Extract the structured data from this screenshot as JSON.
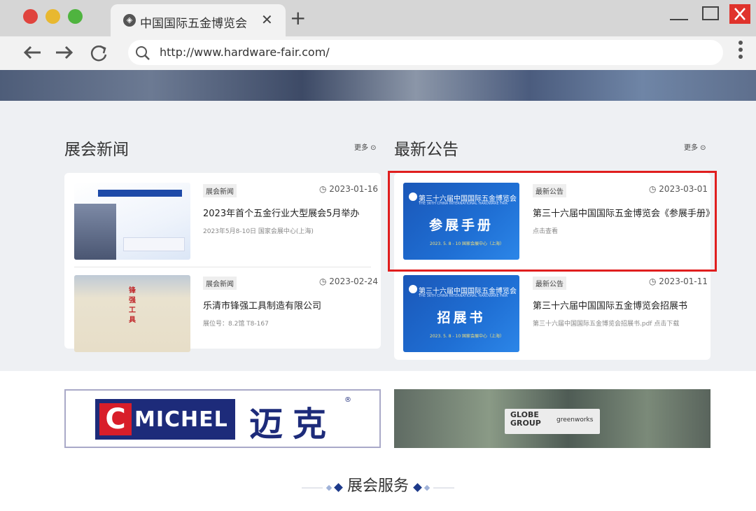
{
  "browser": {
    "tab_title": "中国国际五金博览会",
    "tab_close": "✕",
    "new_tab": "+",
    "url": "http://www.hardware-fair.com/"
  },
  "news": {
    "title": "展会新闻",
    "more": "更多 ⊙",
    "items": [
      {
        "tag": "展会新闻",
        "date": "2023-01-16",
        "title": "2023年首个五金行业大型展会5月举办",
        "subtitle": "2023年5月8-10日 国家会展中心(上海)"
      },
      {
        "tag": "展会新闻",
        "date": "2023-02-24",
        "title": "乐清市锋强工具制造有限公司",
        "subtitle": "展位号：8.2馆 T8-167"
      }
    ],
    "thumb2_sign": "锋强工具"
  },
  "notices": {
    "title": "最新公告",
    "more": "更多 ⊙",
    "items": [
      {
        "tag": "最新公告",
        "date": "2023-03-01",
        "title": "第三十六届中国国际五金博览会《参展手册》",
        "subtitle": "点击查看",
        "img_head": "第三十六届中国国际五金博览会",
        "img_sub": "THE 36TH CHINA INTERNATIONAL HARDWARE FAIR",
        "img_main": "参展手册",
        "img_foot": "2023. 5. 8 - 10  国家会展中心（上海）"
      },
      {
        "tag": "最新公告",
        "date": "2023-01-11",
        "title": "第三十六届中国国际五金博览会招展书",
        "subtitle": "第三十六届中国国际五金博览会招展书.pdf 点击下载",
        "img_head": "第三十六届中国国际五金博览会",
        "img_sub": "THE 36TH CHINA INTERNATIONAL HARDWARE FAIR",
        "img_main": "招展书",
        "img_foot": "2023. 5. 8 - 10  国家会展中心（上海）"
      }
    ]
  },
  "ads": {
    "michel_c": "C",
    "michel_text": "MICHEL",
    "michel_cn": "迈克",
    "michel_reg": "®",
    "globe_text": "GLOBE GROUP",
    "globe_brand": "greenworks"
  },
  "services": {
    "title": "展会服务"
  },
  "colors": {
    "highlight": "#e01e1e",
    "brand_blue": "#1a57b8"
  }
}
